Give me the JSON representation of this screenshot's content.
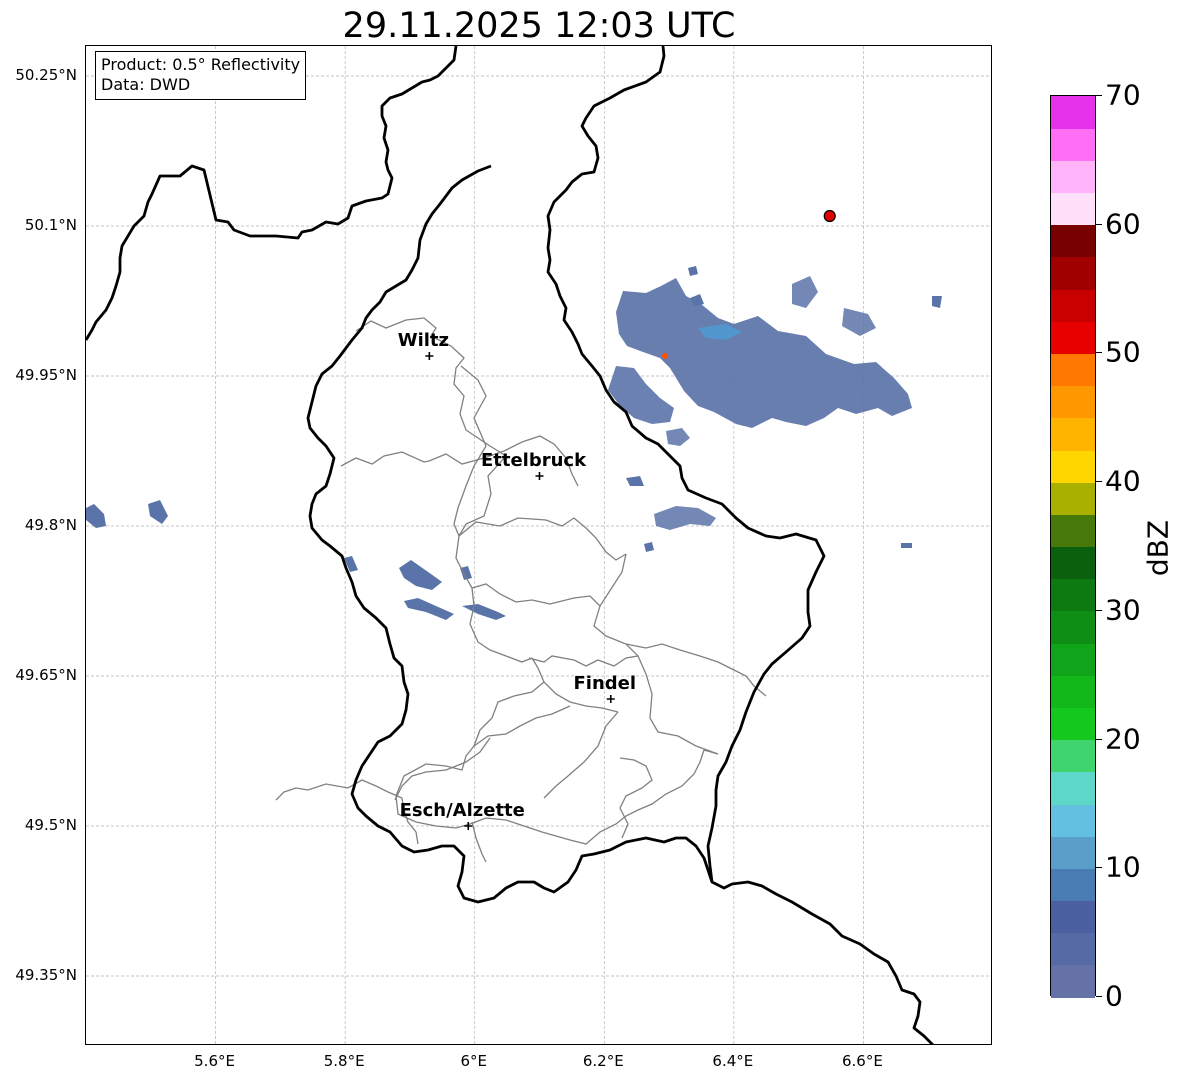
{
  "title": "29.11.2025 12:03 UTC",
  "info_box": {
    "product": "Product: 0.5° Reflectivity",
    "data_source": "Data: DWD"
  },
  "map": {
    "extent": {
      "lon_min": 5.4,
      "lon_max": 6.8,
      "lat_min": 49.28,
      "lat_max": 50.28
    },
    "lat_ticks": [
      {
        "value": 50.25,
        "label": "50.25°N"
      },
      {
        "value": 50.1,
        "label": "50.1°N"
      },
      {
        "value": 49.95,
        "label": "49.95°N"
      },
      {
        "value": 49.8,
        "label": "49.8°N"
      },
      {
        "value": 49.65,
        "label": "49.65°N"
      },
      {
        "value": 49.5,
        "label": "49.5°N"
      },
      {
        "value": 49.35,
        "label": "49.35°N"
      }
    ],
    "lon_ticks": [
      {
        "value": 5.6,
        "label": "5.6°E"
      },
      {
        "value": 5.8,
        "label": "5.8°E"
      },
      {
        "value": 6.0,
        "label": "6°E"
      },
      {
        "value": 6.2,
        "label": "6.2°E"
      },
      {
        "value": 6.4,
        "label": "6.4°E"
      },
      {
        "value": 6.6,
        "label": "6.6°E"
      }
    ],
    "grid": true,
    "cities": [
      {
        "name": "Wiltz",
        "lon": 5.93,
        "lat": 49.97
      },
      {
        "name": "Ettelbruck",
        "lon": 6.1,
        "lat": 49.85
      },
      {
        "name": "Findel",
        "lon": 6.21,
        "lat": 49.627
      },
      {
        "name": "Esch/Alzette",
        "lon": 5.99,
        "lat": 49.5
      }
    ],
    "radar_site": {
      "lon": 6.548,
      "lat": 50.11,
      "color": "#e00000"
    },
    "echo_color": "#5a73a8",
    "echo_color_light": "#4e9bd2"
  },
  "colorbar": {
    "unit": "dBZ",
    "min": 0,
    "max": 70,
    "step": 2.5,
    "ticks": [
      0,
      10,
      20,
      30,
      40,
      50,
      60,
      70
    ],
    "colors": [
      "#6472a8",
      "#566aa5",
      "#4a60a0",
      "#4a7cb4",
      "#5a9fca",
      "#64c0e0",
      "#5dd8c8",
      "#3fd46e",
      "#14c81e",
      "#12b81a",
      "#10a41a",
      "#0e8e14",
      "#0c7a10",
      "#0a600c",
      "#46780a",
      "#aab000",
      "#ffd600",
      "#ffb400",
      "#ff9800",
      "#ff7800",
      "#e60000",
      "#c80000",
      "#a00000",
      "#780000",
      "#ffe0fa",
      "#ffb4fa",
      "#ff6ef5",
      "#e632eb"
    ]
  }
}
